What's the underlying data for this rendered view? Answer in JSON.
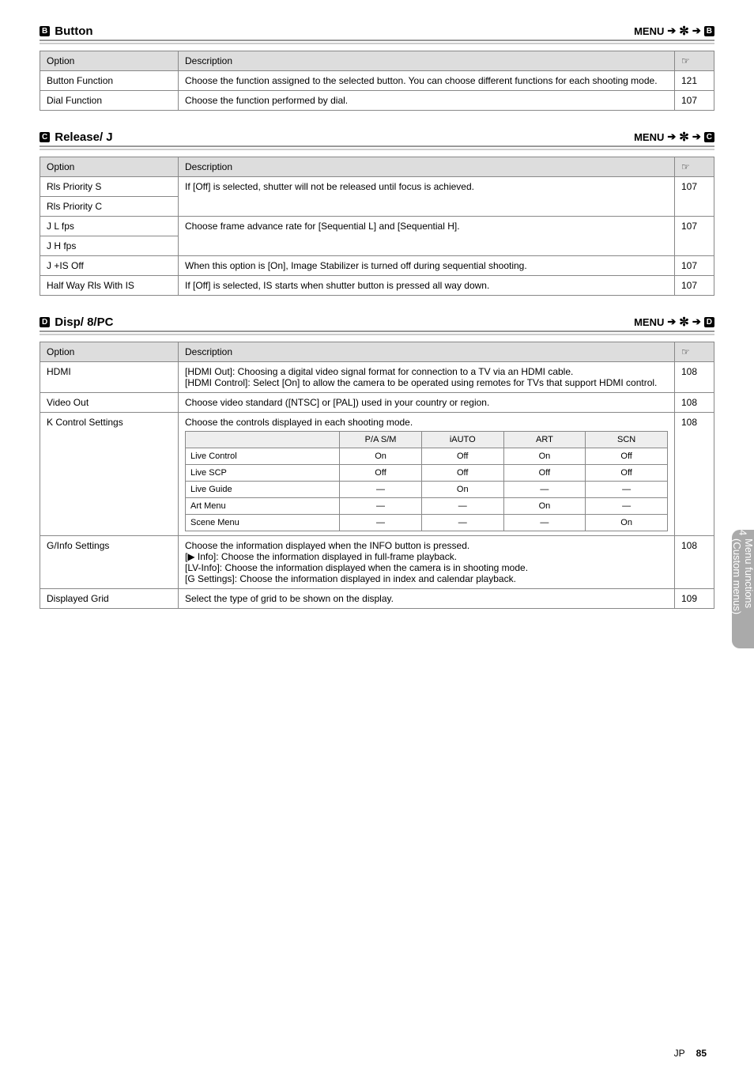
{
  "sections": {
    "b": {
      "badge": "B",
      "title": "Button",
      "path_prefix": "MENU",
      "path_gear": "✼",
      "header": {
        "option": "Option",
        "desc": "Description",
        "page": "g"
      },
      "rows": [
        {
          "opt": "Button Function",
          "desc": "Choose the function assigned to the selected button. You can choose different functions for each shooting mode.",
          "pg": "121"
        },
        {
          "opt": "Dial Function",
          "desc": "Choose the function performed by dial.",
          "pg": "107"
        }
      ]
    },
    "c": {
      "badge": "C",
      "title": "Release/  J",
      "path_prefix": "MENU",
      "header": {
        "option": "Option",
        "desc": "Description",
        "page": "g"
      },
      "rows": [
        {
          "opt": "Rls Priority S",
          "desc": "If [Off] is selected, shutter will not be released until focus is achieved.",
          "pg": "107"
        },
        {
          "opt": "Rls Priority C",
          "desc": "",
          "pg": ""
        },
        {
          "opt": "J L fps",
          "desc": "Choose frame advance rate for [Sequential L] and [Sequential H].",
          "pg": "107"
        },
        {
          "opt": "J H fps",
          "desc": "",
          "pg": ""
        },
        {
          "opt": "J +IS Off",
          "desc": "When this option is [On], Image Stabilizer is turned off during sequential shooting.",
          "pg": "107"
        },
        {
          "opt": "Half Way Rls With IS",
          "desc": "If [Off] is selected, IS starts when shutter button is pressed all way down.",
          "pg": "107"
        }
      ]
    },
    "d": {
      "badge": "D",
      "title": "Disp/  8/PC",
      "path_prefix": "MENU",
      "header": {
        "option": "Option",
        "desc": "Description",
        "page": "g"
      },
      "rows": [
        {
          "opt": "HDMI",
          "desc": "[HDMI Out]: Choosing a digital video signal format for connection to a TV via an HDMI cable.\n[HDMI Control]: Select [On] to allow the camera to be operated using remotes for TVs that support HDMI control.",
          "pg": "108"
        },
        {
          "opt": "Video Out",
          "desc": "Choose video standard ([NTSC] or [PAL]) used in your country or region.",
          "pg": "108"
        }
      ],
      "control_row": {
        "opt": "K Control Settings",
        "desc_lead": "Choose the controls displayed in each shooting mode.",
        "pg": "108",
        "headers": [
          "",
          "P/A S/M",
          "iAUTO",
          "ART",
          "SCN"
        ],
        "subrows": [
          [
            "Live Control",
            "On",
            "Off",
            "On",
            "Off"
          ],
          [
            "Live SCP",
            "Off",
            "Off",
            "Off",
            "Off"
          ],
          [
            "Live Guide",
            "—",
            "On",
            "—",
            "—"
          ],
          [
            "Art Menu",
            "—",
            "—",
            "On",
            "—"
          ],
          [
            "Scene Menu",
            "—",
            "—",
            "—",
            "On"
          ]
        ]
      },
      "info_row": {
        "opt": "G/Info Settings",
        "desc": "Choose the information displayed when the INFO button is pressed.\n[▶ Info]: Choose the information displayed in full-frame playback.\n[LV-Info]: Choose the information displayed when the camera is in shooting mode.\n[G Settings]: Choose the information displayed in index and calendar playback.",
        "pg": "108"
      },
      "last_row": {
        "opt": "Displayed Grid",
        "desc": "Select the type of grid to be shown on the display.",
        "pg": "109"
      }
    }
  },
  "sidebar": {
    "label": "Menu functions (Custom menus)",
    "number": "4"
  },
  "footer": {
    "pg": "85",
    "code": "JP"
  },
  "icons": {
    "arrow": "➔",
    "gear": "✼",
    "pointer": "☞"
  }
}
